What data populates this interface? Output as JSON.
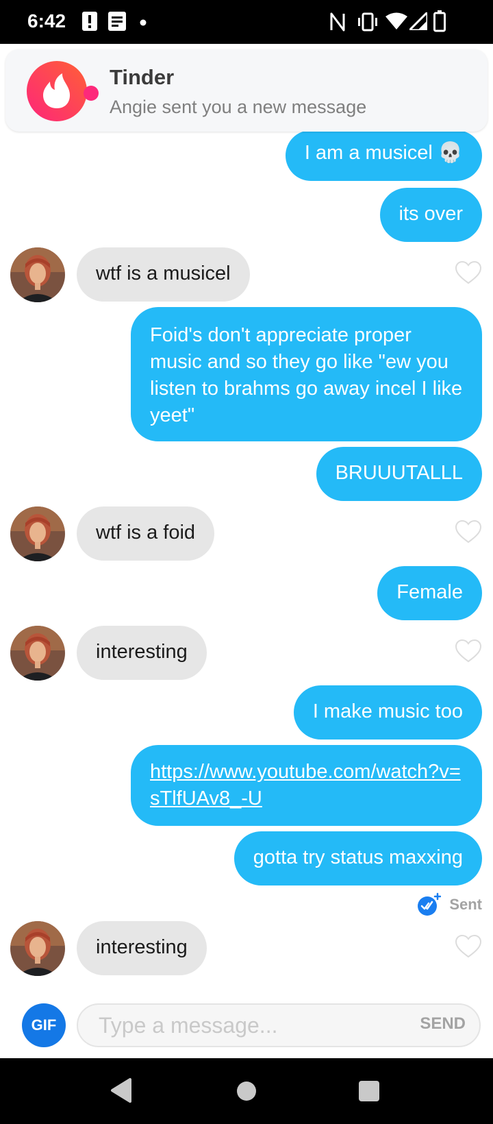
{
  "status_bar": {
    "time": "6:42",
    "left_icons": [
      "alert-icon",
      "document-icon",
      "dot-icon"
    ],
    "right_icons": [
      "nfc-icon",
      "vibrate-icon",
      "wifi-icon",
      "signal-icon",
      "battery-icon"
    ]
  },
  "notification": {
    "app_name": "Tinder",
    "text": "Angie sent you a new message",
    "icon": "tinder-flame-icon",
    "brand_color": "#fd297b"
  },
  "messages": [
    {
      "from": "me",
      "text": "I am a musicel 💀"
    },
    {
      "from": "me",
      "text": "its over"
    },
    {
      "from": "match",
      "text": "wtf is a musicel"
    },
    {
      "from": "me",
      "text": "Foid's don't appreciate proper music and so they go like \"ew you listen to brahms go away incel I like yeet\""
    },
    {
      "from": "me",
      "text": "BRUUUTALLL"
    },
    {
      "from": "match",
      "text": "wtf is a foid"
    },
    {
      "from": "me",
      "text": "Female"
    },
    {
      "from": "match",
      "text": "interesting"
    },
    {
      "from": "me",
      "text": "I make music too"
    },
    {
      "from": "me",
      "text": "https://www.youtube.com/watch?v=sTlfUAv8_-U",
      "is_link": true
    },
    {
      "from": "me",
      "text": "gotta try status maxxing"
    },
    {
      "from": "match",
      "text": "interesting"
    }
  ],
  "read_receipt": {
    "label": "Sent",
    "icon": "double-check-icon"
  },
  "composer": {
    "gif_label": "GIF",
    "placeholder": "Type a message...",
    "value": "",
    "send_label": "SEND"
  },
  "nav_bar": {
    "icons": [
      "back-icon",
      "home-icon",
      "recents-icon"
    ]
  },
  "colors": {
    "outgoing_bubble": "#24baf7",
    "incoming_bubble": "#e6e6e6",
    "gif_button": "#1478e6",
    "read_check": "#1a7ef0"
  }
}
